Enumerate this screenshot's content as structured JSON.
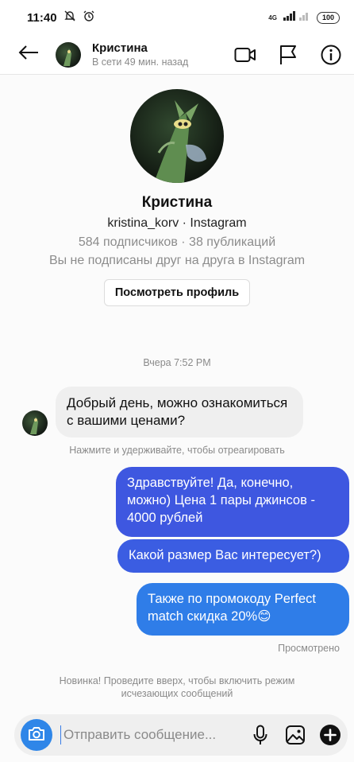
{
  "status_bar": {
    "time": "11:40",
    "network_label": "4G",
    "battery": "100"
  },
  "header": {
    "name": "Кристина",
    "status": "В сети 49 мин. назад"
  },
  "profile": {
    "name": "Кристина",
    "username_line": "kristina_korv · Instagram",
    "stats": "584 подписчиков · 38 публикаций",
    "relation": "Вы не подписаны друг на друга в Instagram",
    "view_profile_label": "Посмотреть профиль"
  },
  "conversation": {
    "timestamp": "Вчера 7:52 PM",
    "incoming": [
      {
        "text": "Добрый день, можно ознакомиться с вашими ценами?"
      }
    ],
    "react_hint": "Нажмите и удерживайте, чтобы отреагировать",
    "outgoing": [
      {
        "text": "Здравствуйте! Да, конечно, можно) Цена 1 пары джинсов - 4000 рублей"
      },
      {
        "text": "Какой размер Вас интересует?)"
      },
      {
        "text": "Также по промокоду Perfect match скидка 20%😊"
      }
    ],
    "seen_label": "Просмотрено",
    "vanish_hint": "Новинка! Проведите вверх, чтобы включить режим исчезающих сообщений"
  },
  "composer": {
    "placeholder": "Отправить сообщение..."
  },
  "icons": {
    "back": "arrow-left-icon",
    "video": "video-camera-icon",
    "flag": "flag-icon",
    "info": "info-icon",
    "camera": "camera-icon",
    "mic": "microphone-icon",
    "gallery": "image-icon",
    "add": "plus-circle-icon"
  },
  "colors": {
    "outgoing_bubble": "#3e57e0",
    "outgoing_bubble_last": "#2f7de8",
    "incoming_bubble": "#efefef",
    "camera_button": "#2f86e8"
  }
}
